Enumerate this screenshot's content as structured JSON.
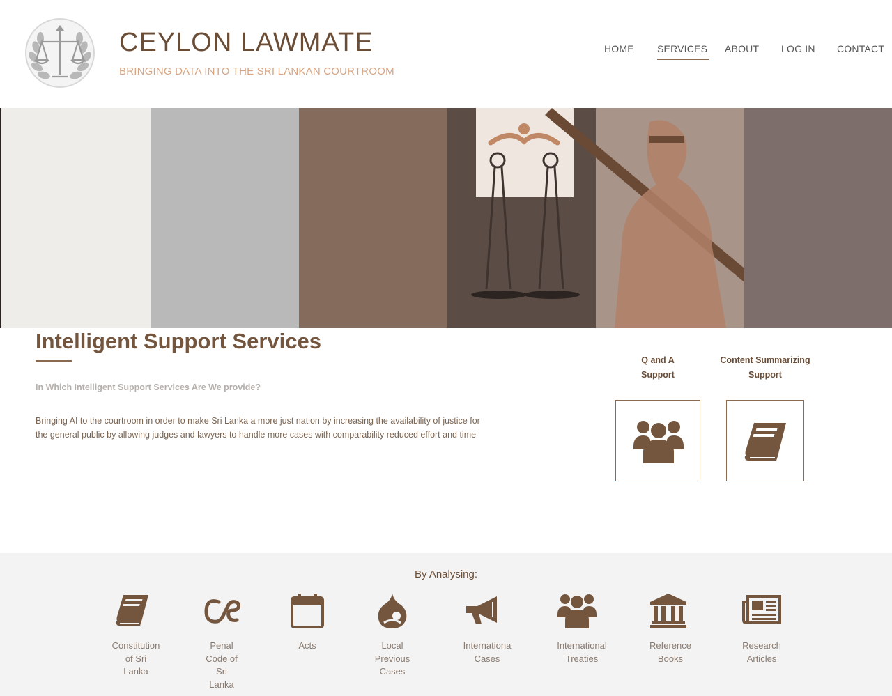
{
  "header": {
    "title": "CEYLON LAWMATE",
    "tagline": "BRINGING DATA INTO THE SRI LANKAN COURTROOM",
    "logo_icon": "scales-laurel-logo"
  },
  "nav": {
    "items": [
      {
        "label": "HOME",
        "active": false
      },
      {
        "label": "SERVICES",
        "active": true
      },
      {
        "label": "ABOUT",
        "active": false
      },
      {
        "label": "LOG IN",
        "active": false
      },
      {
        "label": "CONTACT",
        "active": false
      }
    ]
  },
  "hero": {
    "image": "scales-of-justice-statue",
    "band_colors": [
      "#efedea",
      "#b9b9b9",
      "#846b5c",
      "#5b4c45",
      "#a89489",
      "#7d6e6b"
    ]
  },
  "services": {
    "title": "Intelligent Support Services",
    "subtitle": "In Which Intelligent Support Services Are We provide?",
    "description_line1": "Bringing AI to the courtroom in order to make Sri Lanka a more just nation by increasing the availability of justice for",
    "description_line2": "the general public by allowing judges and lawyers to handle more cases with comparability reduced effort and time",
    "cards": [
      {
        "label_line1": "Q and A",
        "label_line2": "Support",
        "icon": "users-group-icon"
      },
      {
        "label_line1": "Content Summarizing",
        "label_line2": "Support",
        "icon": "book-icon"
      }
    ]
  },
  "analysing": {
    "title": "By Analysing:",
    "sources": [
      {
        "lines": [
          "Constitution",
          "of Sri",
          "Lanka"
        ],
        "icon": "book-icon"
      },
      {
        "lines": [
          "Penal",
          "Code of",
          "Sri",
          "Lanka"
        ],
        "icon": "lastfm-icon"
      },
      {
        "lines": [
          "Acts"
        ],
        "icon": "calendar-icon"
      },
      {
        "lines": [
          "Local",
          "Previous",
          "Cases"
        ],
        "icon": "drupal-icon"
      },
      {
        "lines": [
          "Internationa",
          "Cases"
        ],
        "icon": "megaphone-icon"
      },
      {
        "lines": [
          "International",
          "Treaties"
        ],
        "icon": "users-group-icon"
      },
      {
        "lines": [
          "Reference",
          "Books"
        ],
        "icon": "bank-building-icon"
      },
      {
        "lines": [
          "Research",
          "Articles"
        ],
        "icon": "newspaper-icon"
      }
    ]
  },
  "colors": {
    "brand": "#74563f",
    "accent": "#d6a584",
    "muted": "#b5b0ab"
  }
}
